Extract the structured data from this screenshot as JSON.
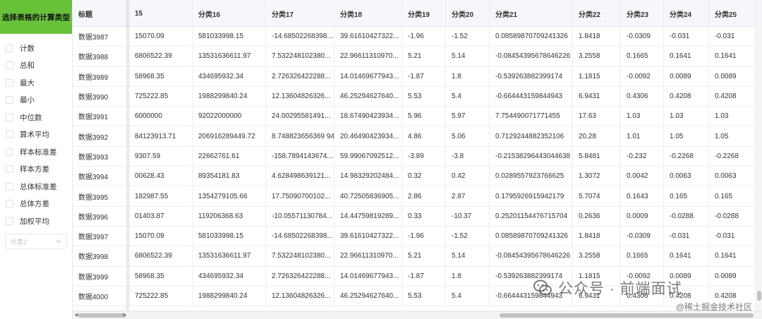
{
  "panel": {
    "title": "选择表格的计算类型",
    "options": [
      "计数",
      "总和",
      "最大",
      "最小",
      "中位数",
      "算术平均",
      "样本标准差",
      "样本方差",
      "总体标准差",
      "总体方差",
      "加权平均"
    ],
    "select_placeholder": "分类2"
  },
  "table": {
    "headers": [
      "标题",
      "15",
      "分类16",
      "分类17",
      "分类18",
      "分类19",
      "分类20",
      "分类21",
      "分类22",
      "分类23",
      "分类24",
      "分类25"
    ],
    "rows": [
      [
        "数据3987",
        "15070.09",
        "581033998.15",
        "-14.68502268398...",
        "39.61610427322...",
        "-1.96",
        "-1.52",
        "0.08589870709241326",
        "1.8418",
        "-0.0309",
        "-0.031",
        "-0.031"
      ],
      [
        "数据3988",
        "6806522.39",
        "13531636611.97",
        "7.532248102380...",
        "22.96611310970...",
        "5.21",
        "5.14",
        "-0.08454395678646226",
        "3.2558",
        "0.1665",
        "0.1641",
        "0.1641"
      ],
      [
        "数据3989",
        "58968.35",
        "434695932.34",
        "2.726326422288...",
        "14.01469677943...",
        "-1.87",
        "1.8",
        "-0.539263882399174",
        "1.1815",
        "-0.0092",
        "0.0089",
        "0.0089"
      ],
      [
        "数据3990",
        "725222.85",
        "1988299840.24",
        "12.13604826326...",
        "46.25294627640...",
        "5.53",
        "5.4",
        "-0.664443159844943",
        "6.9431",
        "0.4306",
        "0.4208",
        "0.4208"
      ],
      [
        "数据3991",
        "6000000",
        "92022000000",
        "24.00295581491...",
        "18.67490423934...",
        "5.96",
        "5.97",
        "7.754490071771455",
        "17.63",
        "1.03",
        "1.03",
        "1.03"
      ],
      [
        "数据3992",
        "84123913.71",
        "206916289449.72",
        "8.748823656369 94",
        "20.46490423934...",
        "4.86",
        "5.06",
        "0.7129244882352106",
        "20.28",
        "1.01",
        "1.05",
        "1.05"
      ],
      [
        "数据3993",
        "9307.59",
        "22662761.61",
        "-158.7894143674...",
        "59.99067092512...",
        "-3.89",
        "-3.8",
        "-0.21538296443044638",
        "5.8481",
        "-0.232",
        "-0.2268",
        "-0.2268"
      ],
      [
        "数据3994",
        "00628.43",
        "89354181.83",
        "4.628498639121...",
        "14.98329202484...",
        "0.32",
        "0.42",
        "0.0289557923766625",
        "1.3072",
        "0.0042",
        "0.0063",
        "0.0063"
      ],
      [
        "数据3995",
        "182987.55",
        "1354279105.66",
        "17.75090700102...",
        "40.72505836905...",
        "2.86",
        "2.87",
        "0.1795926915942179",
        "5.7074",
        "0.1643",
        "0.165",
        "0.165"
      ],
      [
        "数据3996",
        "01403.87",
        "119206368.63",
        "-10.05571130784...",
        "14.44759819289...",
        "0.33",
        "-10.37",
        "0.25201154476715704",
        "0.2636",
        "0.0009",
        "-0.0288",
        "-0.0288"
      ],
      [
        "数据3997",
        "15070.09",
        "581033998.15",
        "-14.68502268398...",
        "39.61610427322...",
        "-1.96",
        "-1.52",
        "0.08589870709241326",
        "1.8418",
        "-0.0309",
        "-0.031",
        "-0.031"
      ],
      [
        "数据3998",
        "6806522.39",
        "13531636611.97",
        "7.532248102380...",
        "22.96611310970...",
        "5.21",
        "5.14",
        "-0.08454395678646226",
        "3.2558",
        "0.1665",
        "0.1641",
        "0.1641"
      ],
      [
        "数据3999",
        "58968.35",
        "434695932.34",
        "2.726326422288...",
        "14.01469677943...",
        "-1.87",
        "1.8",
        "-0.539263882399174",
        "1.1815",
        "-0.0092",
        "0.0089",
        "0.0089"
      ],
      [
        "数据4000",
        "725222.85",
        "1988299840.24",
        "12.13604826326...",
        "46.25294627640...",
        "5.53",
        "5.4",
        "-0.664443159844943",
        "6.9431",
        "0.4306",
        "0.4208",
        "0.4208"
      ]
    ]
  },
  "watermark": {
    "main": "公众号 · 前端面试",
    "sub": "@稀土掘金技术社区"
  },
  "icons": {
    "select_chevron": "chevron-down-icon",
    "watermark_logo": "wechat-icon"
  }
}
